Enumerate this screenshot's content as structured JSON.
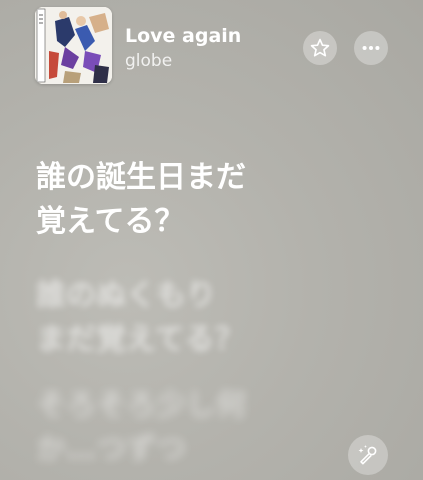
{
  "now_playing": {
    "title": "Love again",
    "artist": "globe",
    "artwork_icon": "album-artwork"
  },
  "controls": {
    "favorite_icon": "star-icon",
    "more_icon": "ellipsis-icon",
    "sing_icon": "microphone-sparkle-icon"
  },
  "lyrics": {
    "active": [
      "誰の誕生日まだ",
      "覚えてる？"
    ],
    "next": [
      "誰のぬくもり",
      "まだ覚えてる？"
    ],
    "after": [
      "そろそろ少し何",
      "か…つずつ"
    ]
  },
  "colors": {
    "background": "#b5b4ae",
    "text": "#ffffff"
  }
}
